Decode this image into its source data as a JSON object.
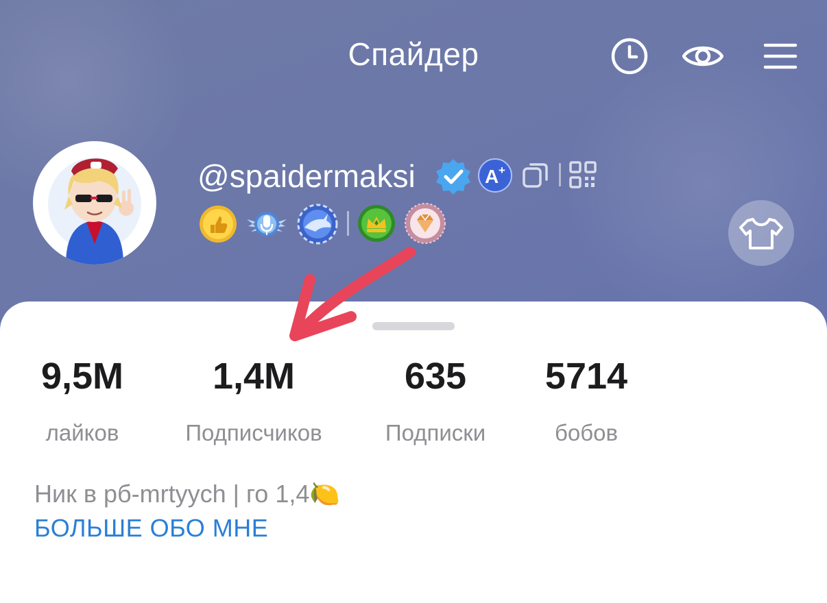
{
  "header": {
    "title": "Спайдер",
    "icons": [
      "clock-icon",
      "eye-icon",
      "menu-icon"
    ],
    "background_color": "#6b77a9"
  },
  "profile": {
    "username": "@spaidermaksi",
    "verified": true,
    "badges": [
      "verified-badge",
      "a-plus-badge",
      "copy-icon",
      "qr-code-icon"
    ],
    "achievements": [
      "thumbs-up-medal",
      "microphone-medal",
      "shark-medal",
      "crown-medal",
      "diamond-medal"
    ],
    "shirt_button": "shirt-icon"
  },
  "stats": [
    {
      "value": "9,5M",
      "label": "лайков"
    },
    {
      "value": "1,4M",
      "label": "Подписчиков"
    },
    {
      "value": "635",
      "label": "Подписки"
    },
    {
      "value": "5714",
      "label": "бобов"
    }
  ],
  "bio": {
    "text": "Ник в рб-mrtyych | го 1,4",
    "emoji": "🍋",
    "more_link": "БОЛЬШЕ ОБО МНЕ",
    "link_color": "#2a7fd6"
  },
  "annotation": {
    "arrow_color": "#e8455a"
  }
}
